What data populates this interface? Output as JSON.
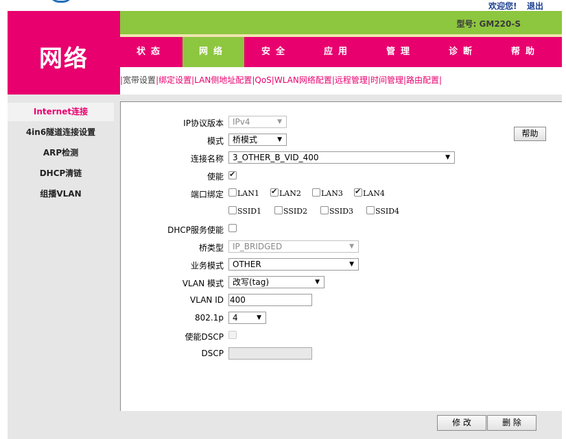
{
  "header": {
    "welcome": "欢迎您!",
    "logout": "退出",
    "model": "型号: GM220-S",
    "section_title": "网络"
  },
  "nav": [
    {
      "label": "状态"
    },
    {
      "label": "网络",
      "active": true
    },
    {
      "label": "安全"
    },
    {
      "label": "应用"
    },
    {
      "label": "管理"
    },
    {
      "label": "诊断"
    },
    {
      "label": "帮助"
    }
  ],
  "subnav": [
    "宽带设置",
    "绑定设置",
    "LAN侧地址配置",
    "QoS",
    "WLAN网络配置",
    "远程管理",
    "时间管理",
    "路由配置"
  ],
  "sidebar": [
    {
      "label": "Internet连接",
      "active": true
    },
    {
      "label": "4in6隧道连接设置"
    },
    {
      "label": "ARP检测"
    },
    {
      "label": "DHCP清链"
    },
    {
      "label": "组播VLAN"
    }
  ],
  "form": {
    "ip_version": {
      "label": "IP协议版本",
      "value": "IPv4"
    },
    "mode": {
      "label": "模式",
      "value": "桥模式"
    },
    "conn_name": {
      "label": "连接名称",
      "value": "3_OTHER_B_VID_400"
    },
    "enable": {
      "label": "使能",
      "checked": true
    },
    "port_bind": {
      "label": "端口绑定",
      "ports": [
        {
          "name": "LAN1",
          "checked": false
        },
        {
          "name": "LAN2",
          "checked": true
        },
        {
          "name": "LAN3",
          "checked": false
        },
        {
          "name": "LAN4",
          "checked": true
        },
        {
          "name": "SSID1",
          "checked": false
        },
        {
          "name": "SSID2",
          "checked": false
        },
        {
          "name": "SSID3",
          "checked": false
        },
        {
          "name": "SSID4",
          "checked": false
        }
      ]
    },
    "dhcp_server": {
      "label": "DHCP服务使能",
      "checked": false
    },
    "bridge_type": {
      "label": "桥类型",
      "value": "IP_BRIDGED"
    },
    "service_mode": {
      "label": "业务模式",
      "value": "OTHER"
    },
    "vlan_mode": {
      "label": "VLAN 模式",
      "value": "改写(tag)"
    },
    "vlan_id": {
      "label": "VLAN ID",
      "value": "400"
    },
    "p8021": {
      "label": "802.1p",
      "value": "4"
    },
    "enable_dscp": {
      "label": "使能DSCP",
      "checked": false
    },
    "dscp": {
      "label": "DSCP",
      "value": ""
    }
  },
  "buttons": {
    "help": "帮助",
    "modify": "修 改",
    "delete": "删 除"
  },
  "colors": {
    "brand_pink": "#e8006f",
    "brand_green": "#8dc63f"
  }
}
